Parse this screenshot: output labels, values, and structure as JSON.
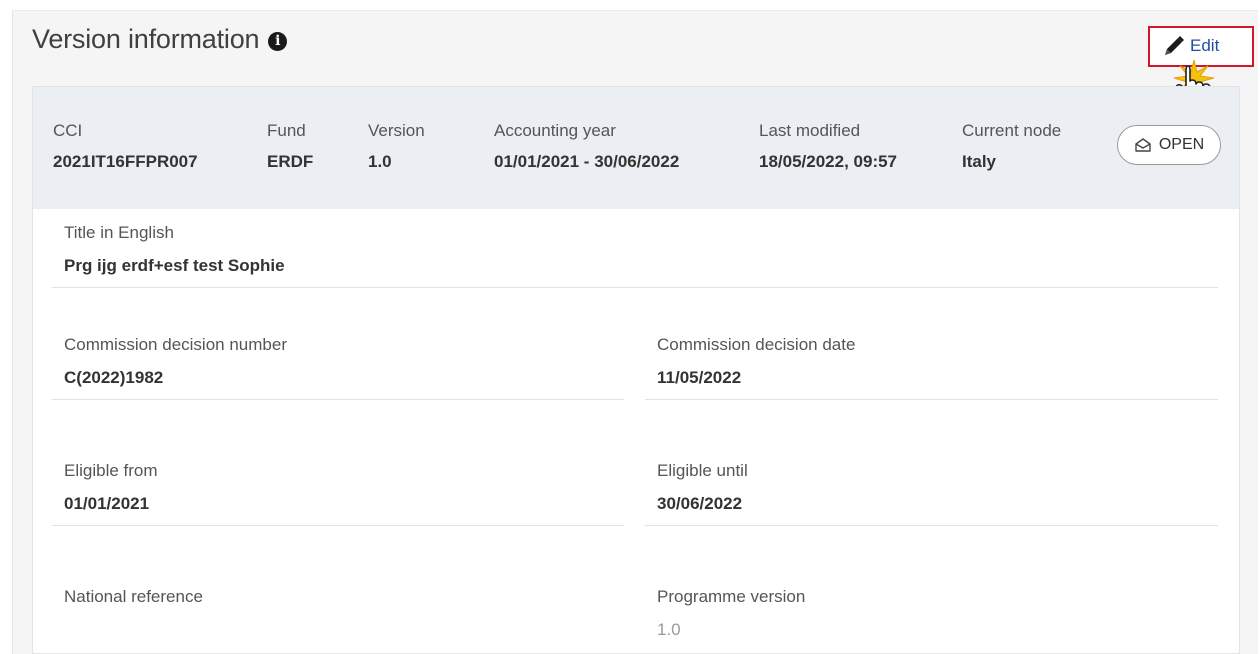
{
  "header": {
    "title": "Version information",
    "edit_label": "Edit"
  },
  "meta": {
    "cci": {
      "label": "CCI",
      "value": "2021IT16FFPR007"
    },
    "fund": {
      "label": "Fund",
      "value": "ERDF"
    },
    "version": {
      "label": "Version",
      "value": "1.0"
    },
    "accounting_year": {
      "label": "Accounting year",
      "value": "01/01/2021 - 30/06/2022"
    },
    "last_modified": {
      "label": "Last modified",
      "value": "18/05/2022, 09:57"
    },
    "current_node": {
      "label": "Current node",
      "value": "Italy"
    },
    "status": "OPEN"
  },
  "fields": {
    "title_en": {
      "label": "Title in English",
      "value": "Prg ijg erdf+esf test Sophie"
    },
    "decision_number": {
      "label": "Commission decision number",
      "value": "C(2022)1982"
    },
    "decision_date": {
      "label": "Commission decision date",
      "value": "11/05/2022"
    },
    "eligible_from": {
      "label": "Eligible from",
      "value": "01/01/2021"
    },
    "eligible_until": {
      "label": "Eligible until",
      "value": "30/06/2022"
    },
    "national_reference": {
      "label": "National reference",
      "value": ""
    },
    "programme_version": {
      "label": "Programme version",
      "value": "1.0"
    }
  },
  "colors": {
    "accent": "#1f4e9d",
    "highlight": "#d0182c",
    "header_bg": "#ebeef2"
  },
  "icons": {
    "info": "info-icon",
    "edit": "pencil-icon",
    "status": "envelope-open-icon",
    "cursor": "hand-cursor-icon"
  }
}
